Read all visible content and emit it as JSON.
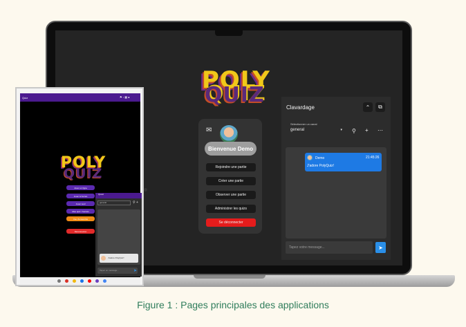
{
  "caption": "Figure 1 : Pages principales des applications",
  "laptop": {
    "logo": {
      "line1": "POLY",
      "line2": "QUIZ"
    },
    "menu": {
      "welcome": "Bienvenue Demo",
      "buttons": [
        "Rejoindre une partie",
        "Créer une partie",
        "Observer une partie",
        "Administrer les quizs"
      ],
      "logout": "Se déconnecter"
    },
    "chat": {
      "title": "Clavardage",
      "collapse_icon": "chevron-up-icon",
      "popout_icon": "external-window-icon",
      "channel_caption": "Sélectionner un canal",
      "channel_value": "general",
      "tools": [
        "search-icon",
        "plus-icon",
        "more-icon"
      ],
      "message": {
        "author": "Demo",
        "time": "21:45:26",
        "text": "J'adore PolyQuiz!"
      },
      "input_placeholder": "Tapez votre message...",
      "send_icon": "send-icon"
    }
  },
  "tablet": {
    "title": "Quiz",
    "logo": {
      "line1": "POLY",
      "line2": "QUIZ"
    },
    "buttons": [
      {
        "label": "Jouer en ligne",
        "color": "#5b2ab0"
      },
      {
        "label": "Jouer à l'écran",
        "color": "#5b2ab0"
      },
      {
        "label": "Jouer seul",
        "color": "#5b2ab0"
      },
      {
        "label": "Mes quiz / Succès",
        "color": "#5b2ab0"
      },
      {
        "label": "Vue d'ensemble",
        "color": "#f08c16"
      },
      {
        "label": "Déconnexion",
        "color": "#e22a2a"
      }
    ],
    "chat": {
      "header": "Quest",
      "channel": "general",
      "message": "J'adore PolyQuiz!",
      "input_placeholder": "Tapez un message..."
    }
  }
}
